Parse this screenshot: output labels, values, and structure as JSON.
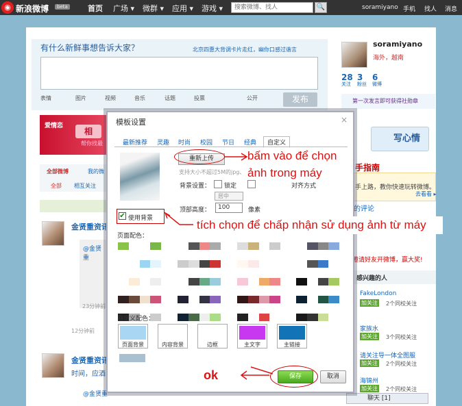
{
  "topbar": {
    "logo_text": "新浪微博",
    "beta": "beta",
    "nav": [
      "首页",
      "广场",
      "微群",
      "应用",
      "游戏"
    ],
    "nav_suffix": "▾",
    "search_placeholder": "搜索微博、找人",
    "search_icon": "🔍",
    "user": "soramiyano",
    "links": [
      "手机",
      "找人",
      "消息"
    ]
  },
  "compose": {
    "prompt": "有什么新鲜事想告诉大家？",
    "trend": "北京四惠大背调卡片走红，幽你口感过谐言",
    "tools": [
      "表情",
      "图片",
      "视频",
      "音乐",
      "话题",
      "投票"
    ],
    "public": "公开",
    "publish": "发布"
  },
  "profile": {
    "name": "soramiyano",
    "location": "海外，越南",
    "stats": [
      {
        "value": "28",
        "label": "关注"
      },
      {
        "value": "3",
        "label": "粉丝"
      },
      {
        "value": "6",
        "label": "微博"
      }
    ],
    "promo": "第一次发言即可获得社勋章"
  },
  "banner": {
    "title": "爱情恋",
    "heart": "相",
    "sub": "帮你找最"
  },
  "feed": {
    "tabs": [
      "全部微博",
      "我的微"
    ],
    "subtabs": [
      "全部",
      "相互关注"
    ],
    "items": [
      {
        "name": "金贤重资讯",
        "quote": "@金贤重",
        "meta": "23分钟前",
        "time": "12分钟前"
      },
      {
        "name": "金贤重资讯",
        "extra": "时间，应酒",
        "quote": "@金贤重"
      }
    ]
  },
  "right": {
    "write": "写心情",
    "guide_title": "手指南",
    "guide_text": "手上路，教你快速玩转微博。",
    "guide_more": "去看看 ▸",
    "comments": "的评论",
    "invite": "邀请好友开微博，赢大奖!",
    "rec_title": "感兴趣的人",
    "recs": [
      {
        "name": "FakeLondon",
        "follow": "加关注",
        "count": "2个同校关注"
      },
      {
        "name": "家族水",
        "follow": "加关注",
        "count": "3个同校关注"
      },
      {
        "name": "请关注导一体全图服",
        "follow": "加关注",
        "count": "2个同校关注"
      },
      {
        "name": "海锦州",
        "follow": "加关注",
        "count": "2个同校关注"
      }
    ],
    "chat": "聊天 [1]"
  },
  "dialog": {
    "title": "模板设置",
    "close": "×",
    "tabs": [
      "最新推荐",
      "灵趣",
      "时尚",
      "校园",
      "节日",
      "经典",
      "自定义"
    ],
    "upload": "重新上传",
    "upload_hint": "支持大小不超过5M的jpg、",
    "bg_setting": "背景设置：",
    "lock": "锁定",
    "align": "对齐方式",
    "position": "居中",
    "height_label": "顶部高度：",
    "height_value": "100",
    "height_unit": "像素",
    "use_bg": "使用背景",
    "page_color": "页面配色：",
    "custom_color": "自定义配色：",
    "custom_boxes": [
      {
        "label": "页面背景",
        "color": "#a9d6f2"
      },
      {
        "label": "内容背景",
        "color": "#ffffff"
      },
      {
        "label": "边框",
        "color": "#ffffff"
      },
      {
        "label": "主文字",
        "color": "#c838f0"
      },
      {
        "label": "主链接",
        "color": "#1273b6"
      }
    ],
    "save": "保存",
    "cancel": "取消",
    "palettes": [
      [
        "#8bc34a",
        "#ffffff",
        "#ffffff",
        "#7ab648"
      ],
      [
        "#ffffff",
        "#555555",
        "#e88",
        "#aaa"
      ],
      [
        "#ddd",
        "#c9b37a",
        "#fff",
        "#ccc"
      ],
      [
        "#fff",
        "#556",
        "#888",
        "#8ad"
      ],
      [
        "#fff",
        "#ffffff",
        "#9cd5f2",
        "#e5f3fb"
      ],
      [
        "#ccc",
        "#ddd",
        "#444",
        "#c33"
      ],
      [
        "#fff8f0",
        "#fbe8e8",
        "#fff",
        "#fff"
      ],
      [
        "#fff",
        "#555",
        "#3a7ac8",
        "#fff"
      ],
      [
        "#fff",
        "#fcebd6",
        "#fff",
        "#eee"
      ],
      [
        "#fff",
        "#444",
        "#6a8",
        "#9cd"
      ],
      [
        "#f8c8d8",
        "#fff",
        "#ea6",
        "#e88"
      ],
      [
        "#111",
        "#fff",
        "#444",
        "#a5c860"
      ],
      [
        "#302020",
        "#6a4a3a",
        "#f0e0d0",
        "#c57"
      ],
      [
        "#223",
        "#fff",
        "#334",
        "#86b"
      ],
      [
        "#301818",
        "#7a2a2a",
        "#d9a",
        "#c48"
      ],
      [
        "#0c2233",
        "#fff",
        "#254",
        "#3a8bc8"
      ],
      [
        "#222",
        "#aaa",
        "#fff",
        "#ccc"
      ],
      [
        "#123",
        "#4a6a4a",
        "#eee",
        "#ad8"
      ],
      [
        "#222",
        "#fff",
        "#d44",
        "#fff"
      ],
      [
        "#1a1a1a",
        "#333",
        "#cd9",
        "#fff"
      ]
    ]
  },
  "annotations": {
    "upload_1": "bấm vào để chọn",
    "upload_2": "ảnh trong máy",
    "use_bg": "tích chọn để chấp nhận sử dụng ảnh từ máy",
    "ok": "ok"
  },
  "colors": {
    "accent": "#1a66b5",
    "annotation": "#d11111",
    "save": "#4aa81c"
  }
}
